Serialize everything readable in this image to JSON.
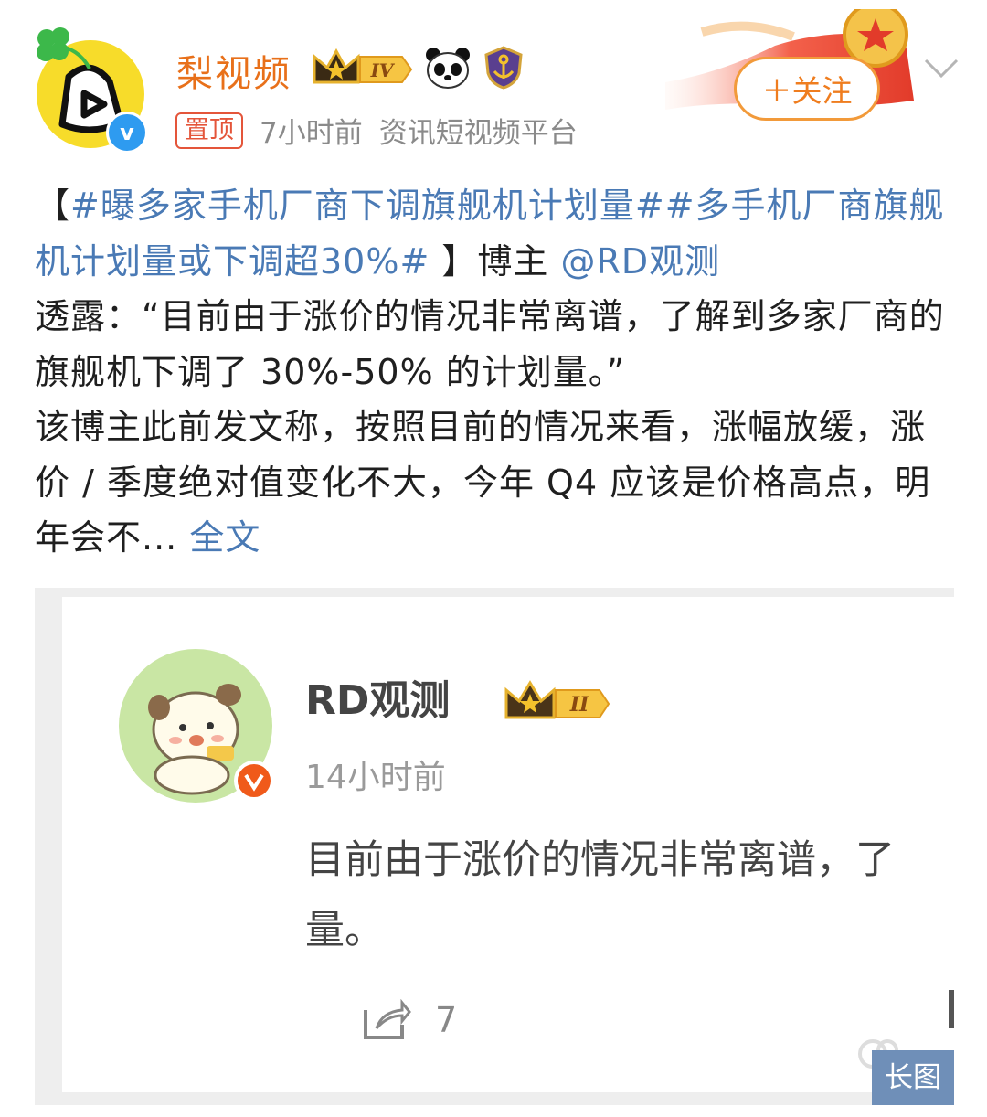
{
  "account": {
    "name": "梨视频",
    "level_badge": "IV",
    "pin_label": "置顶",
    "time": "7小时前",
    "description": "资讯短视频平台",
    "verified_mark": "v"
  },
  "follow_button": {
    "label": "＋关注"
  },
  "post": {
    "open_bracket": "【",
    "tag1": "#曝多家手机厂商下调旗舰机计划量#",
    "tag2": "#多手机厂商旗舰机计划量或下调超30%#",
    "close_bracket": " 】",
    "pre_mention": "博主 ",
    "mention": "@RD观测",
    "text_line1": "透露：“目前由于涨价的情况非常离谱，了解到多家厂商的旗舰机下调了 30%-50% 的计划量。”",
    "text_line2": "该博主此前发文称，按照目前的情况来看，涨幅放缓，涨价 / 季度绝对值变化不大，今年 Q4 应该是价格高点，明年会不...",
    "more_link": " 全文"
  },
  "embedded_post": {
    "name": "RD观测",
    "level_badge": "II",
    "time": "14小时前",
    "text_line1": "目前由于涨价的情况非常离谱，",
    "text_line1_cut": "了",
    "text_line2": "量。",
    "share_count": "7"
  },
  "long_image_label": "长图",
  "colors": {
    "username": "#e8701a",
    "link": "#4a7ab5",
    "follow_border": "#f29a3a",
    "pin": "#e4553a",
    "verified_blue": "#2e9bf0",
    "verified_orange": "#f05a1a",
    "long_image_bg": "#6f8fb8"
  },
  "icons": [
    "clover-icon",
    "crown-icon",
    "panda-icon",
    "anchor-shield-icon",
    "chevron-down-icon",
    "share-icon"
  ]
}
